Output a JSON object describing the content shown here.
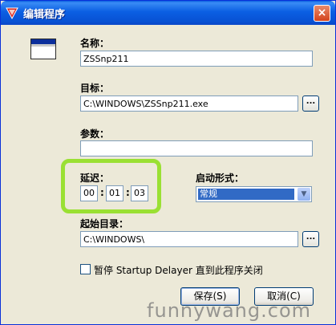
{
  "window": {
    "title": "编辑程序",
    "close_glyph": "×"
  },
  "fields": {
    "name": {
      "label": "名称：",
      "value": "ZSSnp211"
    },
    "target": {
      "label": "目标：",
      "value": "C:\\WINDOWS\\ZSSnp211.exe",
      "browse": "..."
    },
    "params": {
      "label": "参数：",
      "value": ""
    },
    "delay": {
      "label": "延迟：",
      "hours": "00",
      "minutes": "01",
      "seconds": "03",
      "separator": ":"
    },
    "start_mode": {
      "label": "启动形式：",
      "value": "常规"
    },
    "start_dir": {
      "label": "起始目录：",
      "value": "C:\\WINDOWS\\",
      "browse": "..."
    }
  },
  "pause_checkbox": {
    "label": "暂停 Startup Delayer 直到此程序关闭",
    "checked": false
  },
  "buttons": {
    "save": "保存(S)",
    "cancel": "取消(C)"
  },
  "watermark": "funnywang.com",
  "colors": {
    "highlight": "#9ae033",
    "titlebar": "#0b5fe3",
    "selection": "#316ac5"
  },
  "icons": {
    "app": "startup-delayer-app-icon",
    "program": "program-window-icon"
  }
}
